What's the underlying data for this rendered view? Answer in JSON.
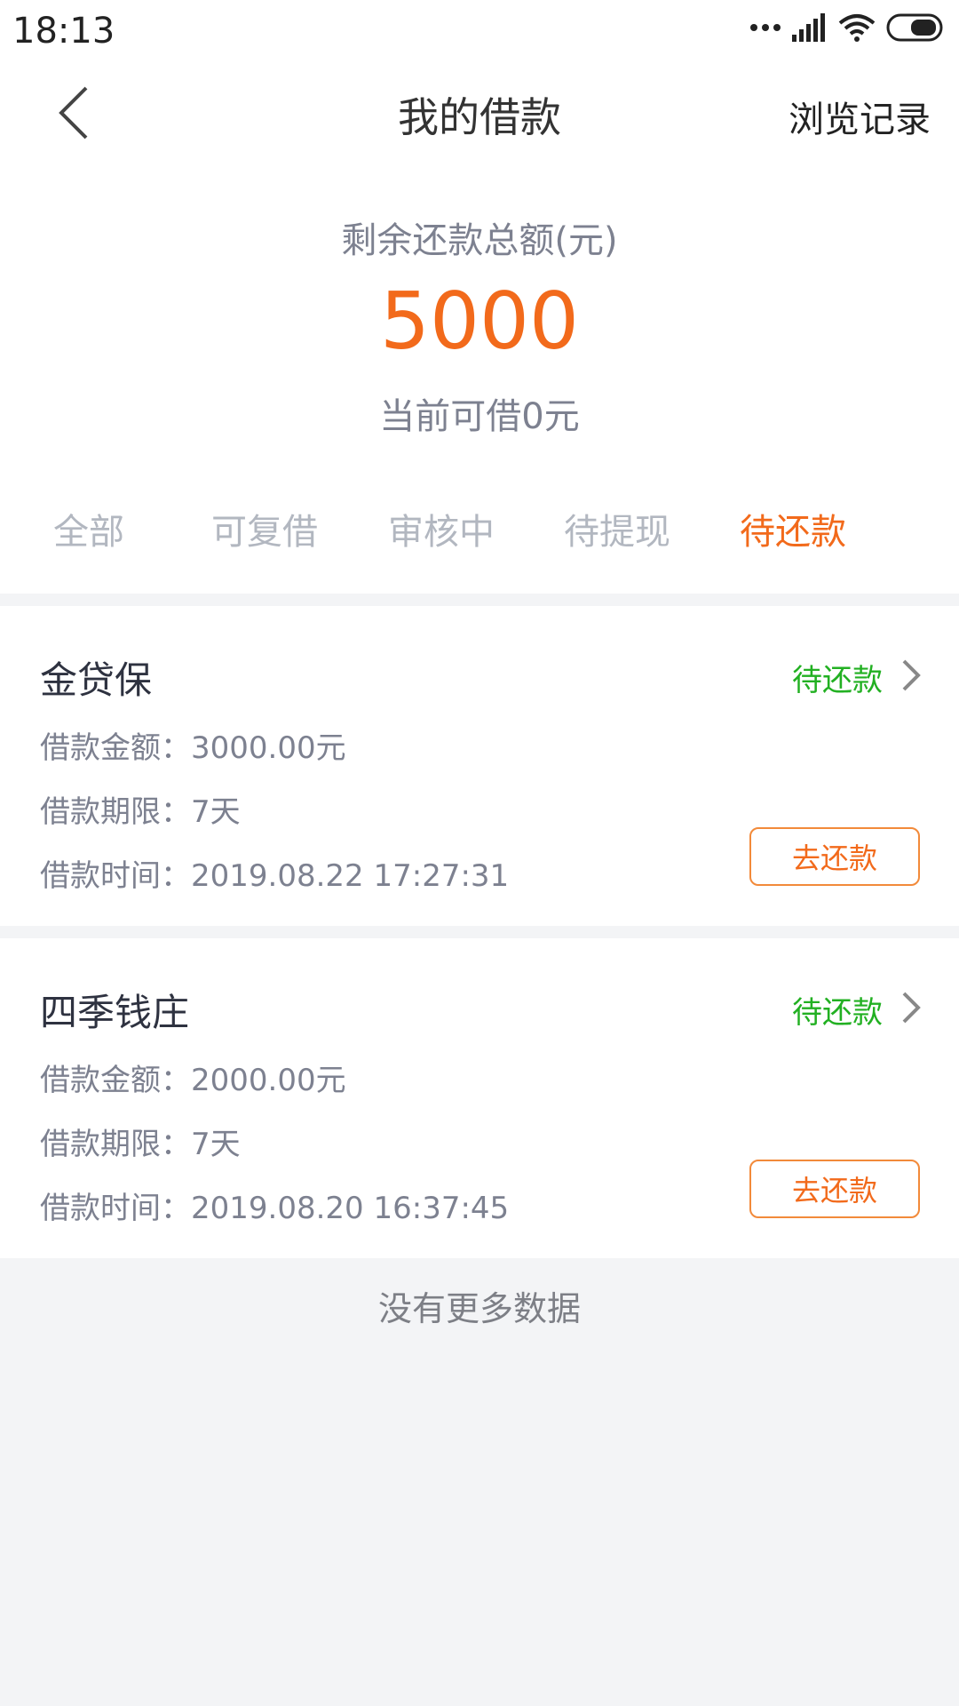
{
  "status_bar": {
    "time": "18:13"
  },
  "nav": {
    "title": "我的借款",
    "right_action": "浏览记录"
  },
  "summary": {
    "label": "剩余还款总额(元)",
    "amount": "5000",
    "available": "当前可借0元"
  },
  "tabs": [
    {
      "label": "全部",
      "active": false
    },
    {
      "label": "可复借",
      "active": false
    },
    {
      "label": "审核中",
      "active": false
    },
    {
      "label": "待提现",
      "active": false
    },
    {
      "label": "待还款",
      "active": true
    }
  ],
  "loans": [
    {
      "name": "金贷保",
      "status": "待还款",
      "amount": "借款金额：3000.00元",
      "term": "借款期限：7天",
      "time": "借款时间：2019.08.22 17:27:31",
      "button": "去还款"
    },
    {
      "name": "四季钱庄",
      "status": "待还款",
      "amount": "借款金额：2000.00元",
      "term": "借款期限：7天",
      "time": "借款时间：2019.08.20 16:37:45",
      "button": "去还款"
    }
  ],
  "footer": {
    "no_more": "没有更多数据"
  },
  "colors": {
    "accent": "#f26a1b",
    "status_green": "#22b022",
    "muted": "#7d8190"
  }
}
